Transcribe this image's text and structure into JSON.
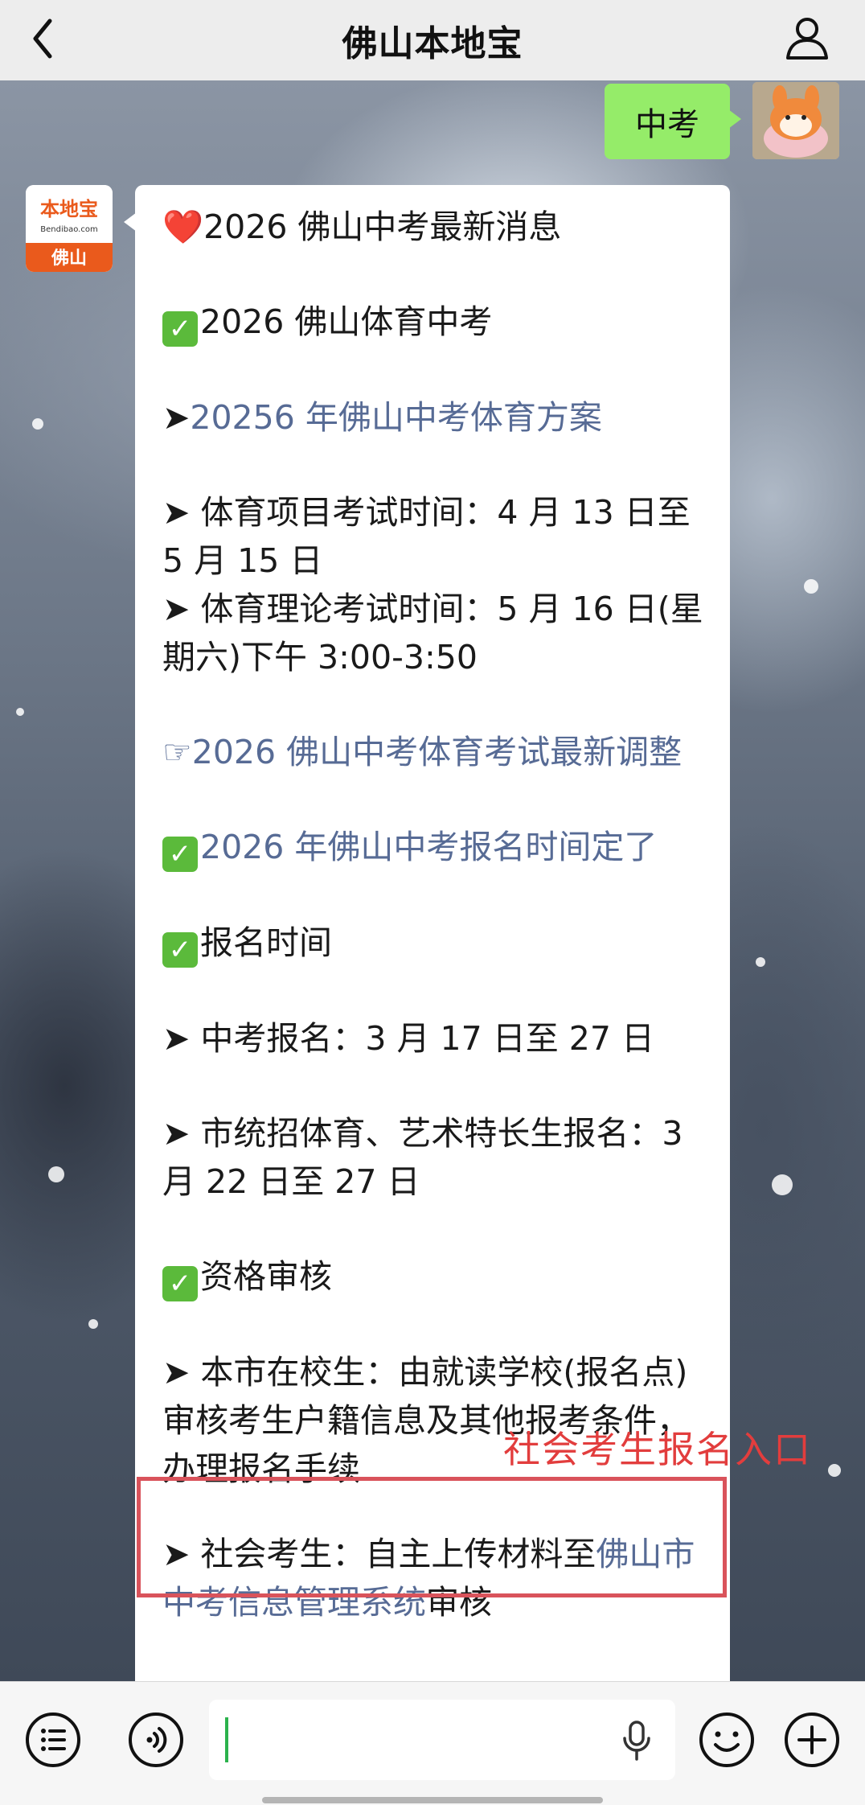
{
  "header": {
    "title": "佛山本地宝",
    "back_icon": "chevron-left-icon",
    "profile_icon": "user-icon"
  },
  "conversation": {
    "user_message": "中考",
    "bot_avatar": {
      "brand_text": "本地宝",
      "domain_text": "Bendibao.com",
      "city_text": "佛山",
      "brand_color": "#ea5a1c"
    },
    "bot_message": {
      "heart_emoji": "❤️",
      "line_news": "2026 佛山中考最新消息",
      "check_sports": "2026 佛山体育中考",
      "link_sports_plan": "20256 年佛山中考体育方案",
      "arrow": "➤",
      "sports_exam_1": " 体育项目考试时间：4 月 13 日至5 月 15 日",
      "sports_exam_2": " 体育理论考试时间：5 月 16 日(星期六)下午 3:00-3:50",
      "pointer_symbol": "☞",
      "link_sports_adjust": "2026 佛山中考体育考试最新调整",
      "link_registration": "2026 年佛山中考报名时间定了",
      "check_reg_time": "报名时间",
      "reg_zhongkao": " 中考报名：3 月 17 日至 27 日",
      "reg_special": " 市统招体育、艺术特长生报名：3 月 22 日至 27 日",
      "check_review": "资格审核",
      "review_school": " 本市在校生：由就读学校(报名点)审核考生户籍信息及其他报考条件，办理报名手续",
      "review_social_prefix": "社会考生：自主上传材料至",
      "review_social_link": "佛山市中考信息管理系统",
      "review_social_suffix": "审核"
    },
    "annotation_label": "社会考生报名入口",
    "annotation_color": "#e23d3d"
  },
  "bottom_bar": {
    "menu_icon": "menu-list-icon",
    "voice_icon": "voice-icon",
    "input_value": "",
    "mic_icon": "microphone-icon",
    "emoji_icon": "emoji-icon",
    "more_icon": "plus-icon"
  },
  "colors": {
    "user_bubble": "#95ec69",
    "link": "#576b95",
    "topbar": "#ededed"
  }
}
